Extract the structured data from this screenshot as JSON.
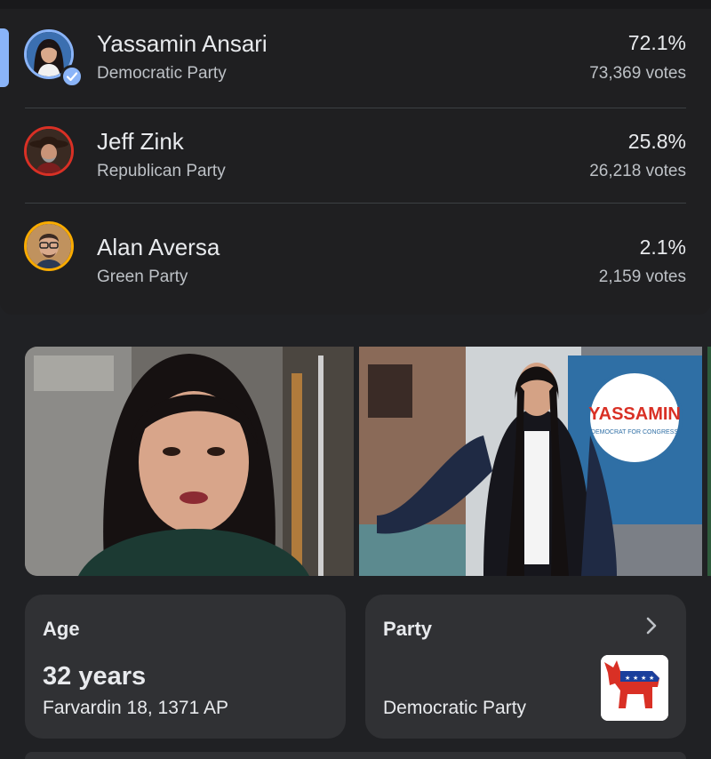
{
  "candidates": [
    {
      "name": "Yassamin Ansari",
      "party": "Democratic Party",
      "percent": "72.1%",
      "votes": "73,369 votes",
      "winner": true,
      "ring_color": "#8ab4f8",
      "icon": "verified-check-icon"
    },
    {
      "name": "Jeff Zink",
      "party": "Republican Party",
      "percent": "25.8%",
      "votes": "26,218 votes",
      "winner": false,
      "ring_color": "#d93025"
    },
    {
      "name": "Alan Aversa",
      "party": "Green Party",
      "percent": "2.1%",
      "votes": "2,159 votes",
      "winner": false,
      "ring_color": "#f9ab00"
    }
  ],
  "photos": {
    "second_sign_text": "YASSAMIN",
    "second_sign_subtext": "DEMOCRAT FOR CONGRESS"
  },
  "age_card": {
    "label": "Age",
    "value": "32 years",
    "date": "Farvardin 18, 1371 AP"
  },
  "party_card": {
    "label": "Party",
    "value": "Democratic Party",
    "logo_icon": "democratic-donkey-logo",
    "chevron_icon": "chevron-right-icon"
  },
  "colors": {
    "accent": "#8ab4f8",
    "background": "#202124",
    "card": "#303134"
  }
}
